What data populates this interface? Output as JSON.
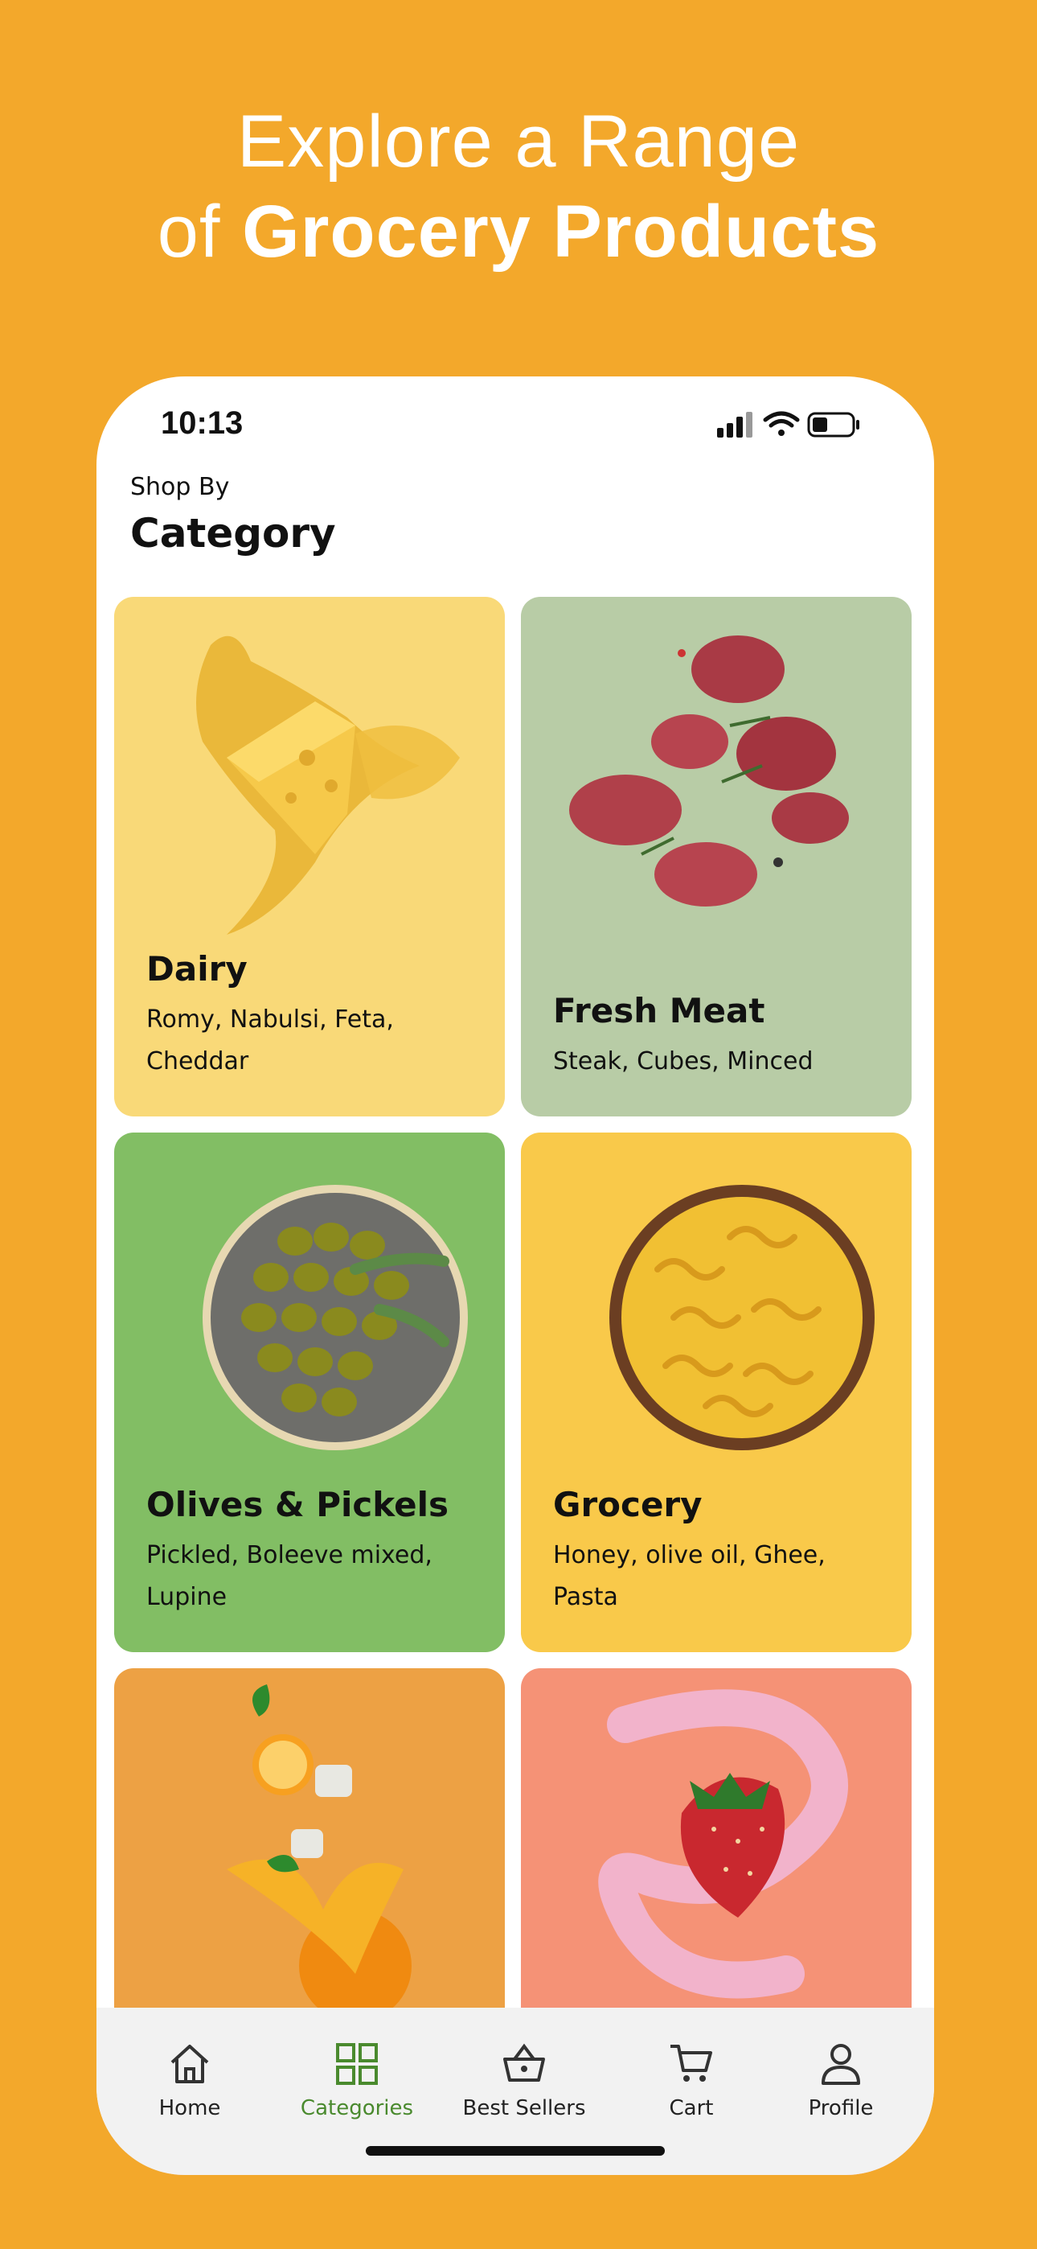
{
  "headline": {
    "line1": "Explore a Range",
    "line2_prefix": "of",
    "line2_bold": "Grocery Products"
  },
  "status_bar": {
    "time": "10:13"
  },
  "page": {
    "subtitle": "Shop By",
    "title": "Category"
  },
  "categories": [
    {
      "name": "Dairy",
      "items": "Romy, Nabulsi, Feta, Cheddar",
      "color": "#F9D978",
      "art": "cheese-splash"
    },
    {
      "name": "Fresh Meat",
      "items": "Steak, Cubes, Minced",
      "color": "#B8CCA6",
      "art": "meat-pieces"
    },
    {
      "name": "Olives & Pickels",
      "items": "Pickled, Boleeve mixed, Lupine",
      "color": "#82BE64",
      "art": "olive-bowl"
    },
    {
      "name": "Grocery",
      "items": "Honey, olive oil, Ghee, Pasta",
      "color": "#F9C94A",
      "art": "pasta-bowl"
    },
    {
      "name": "",
      "items": "",
      "color": "#EDA144",
      "art": "orange-juice-splash"
    },
    {
      "name": "",
      "items": "",
      "color": "#F59276",
      "art": "strawberry-milk-swirl"
    }
  ],
  "tabbar": {
    "active": "Categories",
    "accent": "#4A8A2E",
    "tabs": [
      {
        "label": "Home",
        "icon": "home-icon"
      },
      {
        "label": "Categories",
        "icon": "grid-icon"
      },
      {
        "label": "Best Sellers",
        "icon": "basket-icon"
      },
      {
        "label": "Cart",
        "icon": "cart-icon"
      },
      {
        "label": "Profile",
        "icon": "user-icon"
      }
    ]
  }
}
